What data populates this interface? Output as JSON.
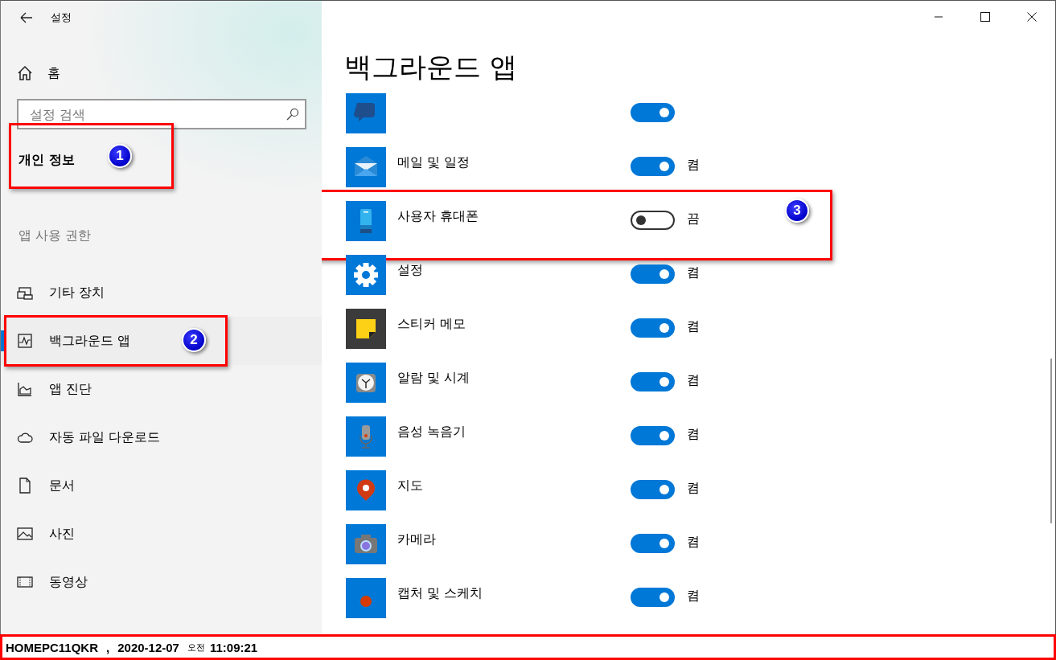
{
  "window": {
    "title": "설정"
  },
  "sidebar": {
    "home": "홈",
    "search": {
      "placeholder": "설정 검색"
    },
    "section": {
      "title": "개인 정보",
      "annotation": "1"
    },
    "group_label": "앱 사용 권한",
    "items": [
      {
        "label": "기타 장치",
        "selected": false
      },
      {
        "label": "백그라운드 앱",
        "selected": true,
        "annotation": "2"
      },
      {
        "label": "앱 진단",
        "selected": false
      },
      {
        "label": "자동 파일 다운로드",
        "selected": false
      },
      {
        "label": "문서",
        "selected": false
      },
      {
        "label": "사진",
        "selected": false
      },
      {
        "label": "동영상",
        "selected": false
      }
    ]
  },
  "main": {
    "title": "백그라운드 앱",
    "apps": [
      {
        "on": true
      },
      {
        "label": "메일 및 일정",
        "on": true,
        "status": "켬"
      },
      {
        "label": "사용자 휴대폰",
        "on": false,
        "status": "끔",
        "annotation": "3"
      },
      {
        "label": "설정",
        "on": true,
        "status": "켬"
      },
      {
        "label": "스티커 메모",
        "on": true,
        "status": "켬"
      },
      {
        "label": "알람 및 시계",
        "on": true,
        "status": "켬"
      },
      {
        "label": "음성 녹음기",
        "on": true,
        "status": "켬"
      },
      {
        "label": "지도",
        "on": true,
        "status": "켬"
      },
      {
        "label": "카메라",
        "on": true,
        "status": "켬"
      },
      {
        "label": "캡처 및 스케치",
        "on": true,
        "status": "켬"
      }
    ]
  },
  "status_bar": {
    "host": "HOMEPC11QKR",
    "separator": ",",
    "date": "2020-12-07",
    "meridiem": "오전",
    "time": "11:09:21"
  }
}
